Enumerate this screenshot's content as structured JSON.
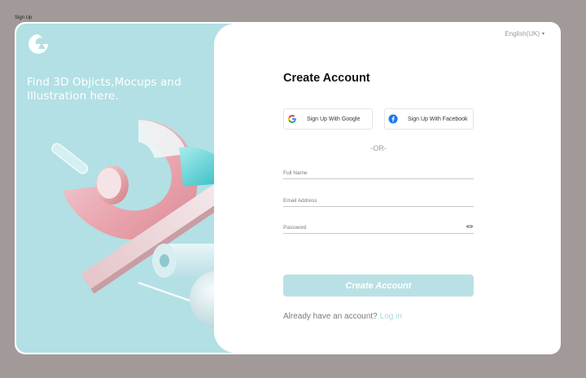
{
  "frame_label": "Sign Up",
  "left_panel": {
    "tagline": "Find 3D Objicts,Mocups and Illustration here.",
    "background": "#b2e0e4"
  },
  "language": {
    "label": "English(UK)",
    "caret": "▾"
  },
  "form": {
    "title": "Create Account",
    "google_label": "Sign Up With Google",
    "facebook_label": "Sign Up With Facebook",
    "divider": "-OR-",
    "full_name_placeholder": "Full Name",
    "email_placeholder": "Email Address",
    "password_placeholder": "Password",
    "submit_label": "Create Account",
    "already_text": "Already have an account?",
    "login_link": "Log in"
  },
  "colors": {
    "page_bg": "#a29a98",
    "accent": "#b9e1e5",
    "link": "#a8d8de"
  }
}
